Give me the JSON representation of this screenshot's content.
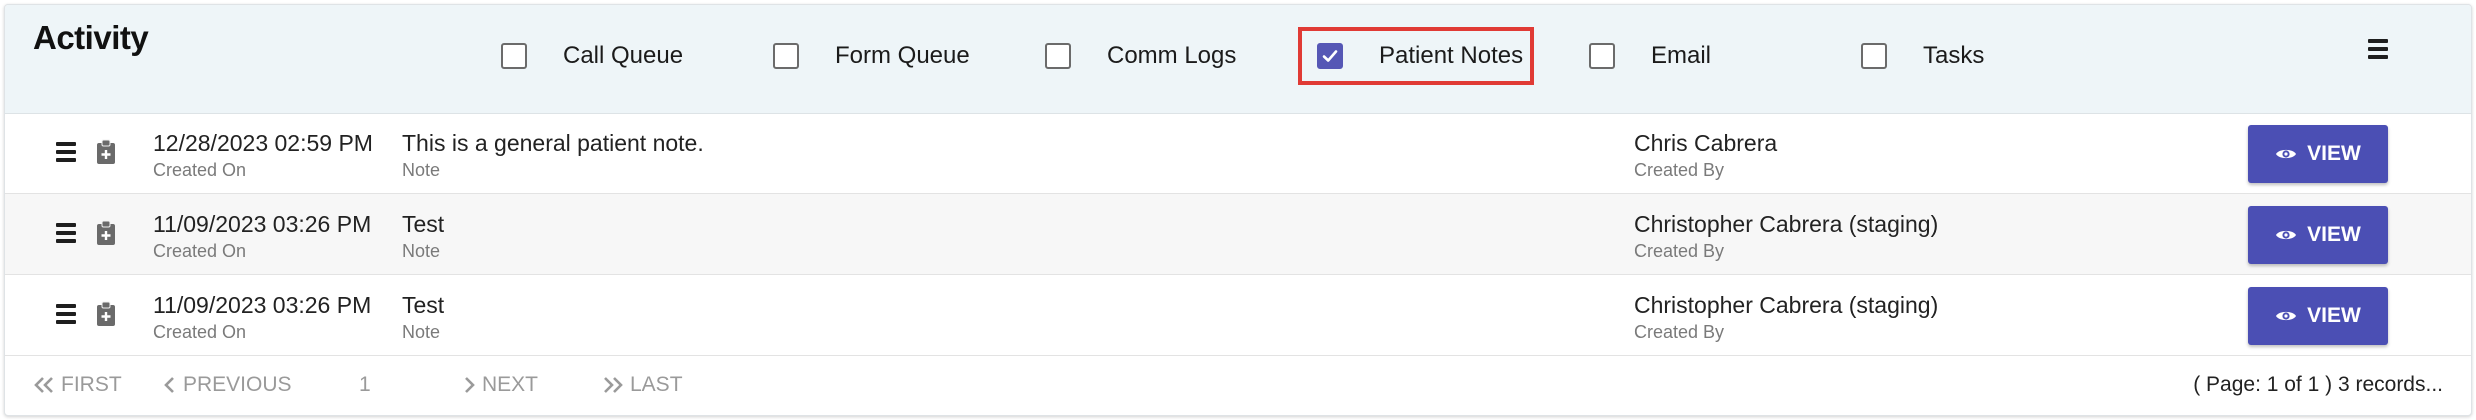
{
  "header": {
    "title": "Activity",
    "filters": [
      {
        "label": "Call Queue",
        "checked": false
      },
      {
        "label": "Form Queue",
        "checked": false
      },
      {
        "label": "Comm Logs",
        "checked": false
      },
      {
        "label": "Patient Notes",
        "checked": true
      },
      {
        "label": "Email",
        "checked": false
      },
      {
        "label": "Tasks",
        "checked": false
      }
    ],
    "menu_icon": "hamburger-menu-icon"
  },
  "rows": [
    {
      "datetime": "12/28/2023 02:59 PM",
      "datetime_label": "Created On",
      "note": "This is a general patient note.",
      "note_label": "Note",
      "author": "Chris Cabrera",
      "author_label": "Created By",
      "view_label": "VIEW"
    },
    {
      "datetime": "11/09/2023 03:26 PM",
      "datetime_label": "Created On",
      "note": "Test",
      "note_label": "Note",
      "author": "Christopher Cabrera (staging)",
      "author_label": "Created By",
      "view_label": "VIEW"
    },
    {
      "datetime": "11/09/2023 03:26 PM",
      "datetime_label": "Created On",
      "note": "Test",
      "note_label": "Note",
      "author": "Christopher Cabrera (staging)",
      "author_label": "Created By",
      "view_label": "VIEW"
    }
  ],
  "pagination": {
    "first": "FIRST",
    "previous": "PREVIOUS",
    "current_page": "1",
    "next": "NEXT",
    "last": "LAST",
    "summary": "( Page: 1 of 1 ) 3 records..."
  },
  "colors": {
    "accent": "#4b4fb4",
    "highlight_border": "#e03a35",
    "header_bg": "#eef5f8"
  }
}
